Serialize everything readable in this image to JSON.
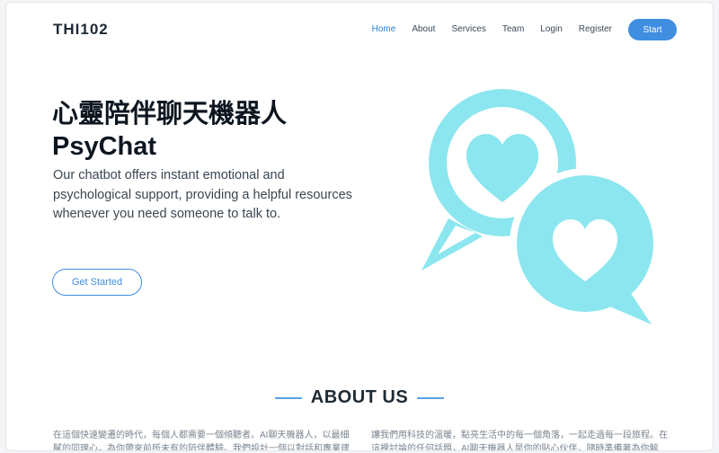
{
  "brand": {
    "logo": "THI102"
  },
  "nav": {
    "items": [
      "Home",
      "About",
      "Services",
      "Team",
      "Login",
      "Register"
    ],
    "active": "Home",
    "start_label": "Start"
  },
  "hero": {
    "title_line1": "心靈陪伴聊天機器人",
    "title_line2": "PsyChat",
    "description": "Our chatbot offers instant emotional and psychological support, providing a helpful resources whenever you need someone to talk to.",
    "cta_label": "Get Started"
  },
  "illustration": {
    "icon": "chat-bubbles-heart-icon",
    "color": "#8be6ef"
  },
  "about": {
    "title": "ABOUT US",
    "left_text": "在這個快速變遷的時代，每個人都需要一個傾聽者。AI聊天機器人，以最細膩的同理心，為你帶來前所未有的陪伴體驗。我們設計一個以對話和專業建議",
    "right_text": "讓我們用科技的溫暖，點亮生活中的每一個角落，一起走過每一段旅程。在這裡討論的任何話題，AI聊天機器人是你的貼心伙伴，隨時準備著為你解憂，帶"
  },
  "colors": {
    "accent": "#3f8ee0",
    "illustration": "#8be6ef"
  }
}
